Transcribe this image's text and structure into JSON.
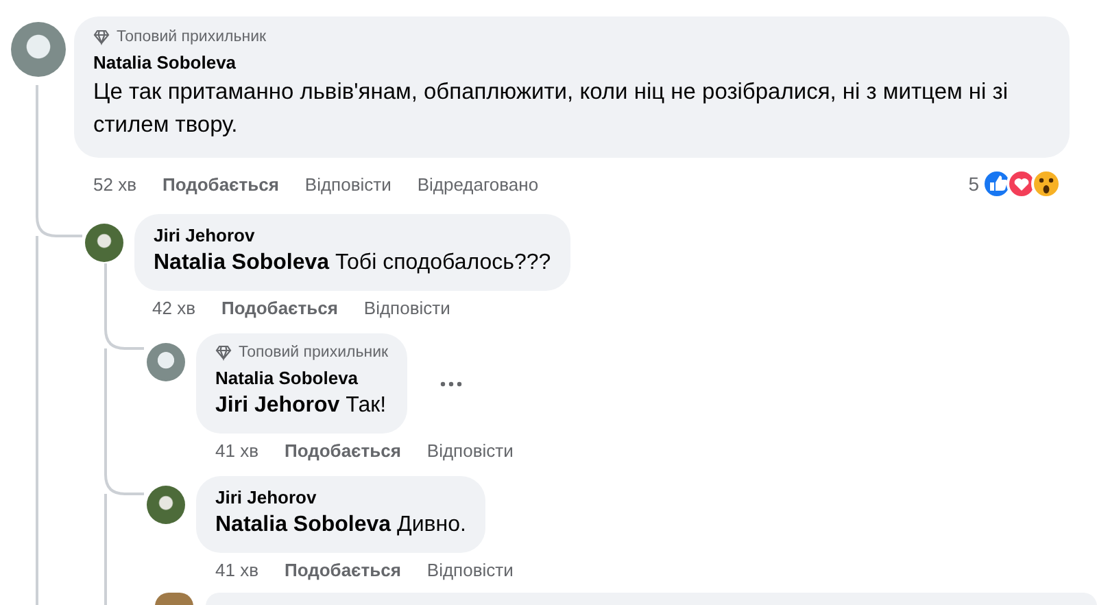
{
  "comment": {
    "badge": "Топовий прихильник",
    "author": "Natalia Soboleva",
    "text": "Це так притаманно львів'янам, обпаплюжити, коли ніц не розібралися, ні з митцем ні зі стилем твору.",
    "time": "52 хв",
    "like": "Подобається",
    "reply": "Відповісти",
    "edited": "Відредаговано",
    "reaction_count": "5",
    "replies": [
      {
        "author": "Jiri Jehorov",
        "mention": "Natalia Soboleva",
        "text": "Тобі сподобалось???",
        "time": "42 хв",
        "like": "Подобається",
        "reply": "Відповісти",
        "replies": [
          {
            "badge": "Топовий прихильник",
            "author": "Natalia Soboleva",
            "mention": "Jiri Jehorov",
            "text": "Так!",
            "time": "41 хв",
            "like": "Подобається",
            "reply": "Відповісти",
            "menu": true
          },
          {
            "author": "Jiri Jehorov",
            "mention": "Natalia Soboleva",
            "text": "Дивно.",
            "time": "41 хв",
            "like": "Подобається",
            "reply": "Відповісти",
            "menu": false
          }
        ]
      }
    ]
  }
}
